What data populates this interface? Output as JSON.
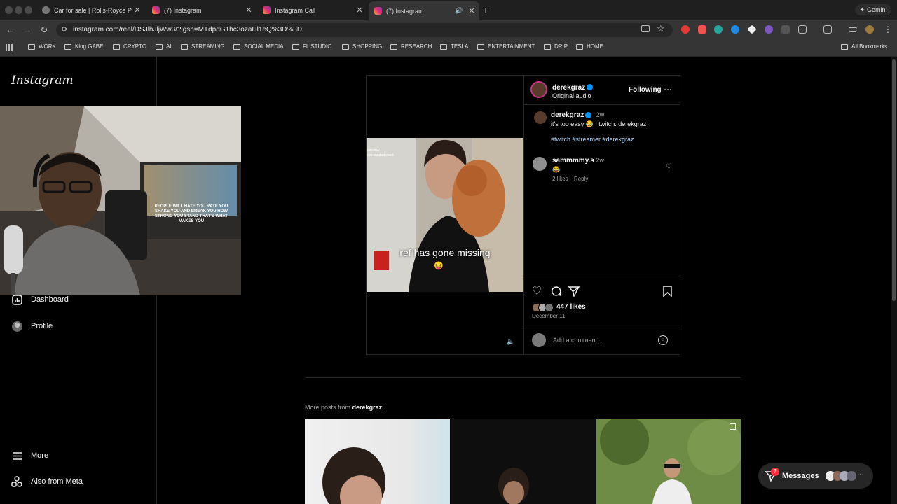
{
  "browser": {
    "tabs": [
      {
        "title": "Car for sale | Rolls-Royce Pha",
        "active": false
      },
      {
        "title": "(7) Instagram",
        "active": false
      },
      {
        "title": "Instagram Call",
        "active": false
      },
      {
        "title": "(7) Instagram",
        "active": true
      }
    ],
    "new_tab": "+",
    "gemini_label": "Gemini",
    "url": "instagram.com/reel/DSJlhJljWw3/?igsh=MTdpdG1hc3ozaHl1eQ%3D%3D",
    "bookmarks": [
      "WORK",
      "King GABE",
      "CRYPTO",
      "AI",
      "STREAMING",
      "SOCIAL MEDIA",
      "FL STUDIO",
      "SHOPPING",
      "RESEARCH",
      "TESLA",
      "ENTERTAINMENT",
      "DRIP",
      "HOME"
    ],
    "all_bookmarks": "All Bookmarks"
  },
  "sidebar": {
    "logo": "Instagram",
    "items": [
      {
        "label": "Dashboard",
        "icon": "chart-icon"
      },
      {
        "label": "Profile",
        "icon": "avatar-icon"
      }
    ],
    "bottom": [
      {
        "label": "More",
        "icon": "menu-icon"
      },
      {
        "label": "Also from Meta",
        "icon": "meta-icon"
      }
    ]
  },
  "webcam_sign": "PEOPLE WILL HATE YOU RATE YOU SHAKE YOU AND BREAK YOU HOW STRONG YOU STAND THAT'S WHAT MAKES YOU",
  "post": {
    "video_overlay": "ref has gone missing",
    "video_corner_text": "wwwww\nsoo sandad crack",
    "author": "derekgraz",
    "audio": "Original audio",
    "follow_label": "Following",
    "caption_user": "derekgraz",
    "caption_time": "2w",
    "caption_text": "it's too easy 😂 | twitch: derekgraz",
    "hashtags": "#twitch #streamer #derekgraz",
    "comment": {
      "user": "sammmmy.s",
      "time": "2w",
      "text": "😂",
      "likes": "2 likes",
      "reply": "Reply"
    },
    "likes": "447 likes",
    "date": "December 11",
    "comment_placeholder": "Add a comment..."
  },
  "more_posts": {
    "prefix": "More posts from",
    "user": "derekgraz"
  },
  "messages": {
    "label": "Messages",
    "badge": "7"
  },
  "colors": {
    "bg": "#000000",
    "accent": "#0095f6",
    "badge": "#ff3040",
    "chrome": "#353535"
  }
}
